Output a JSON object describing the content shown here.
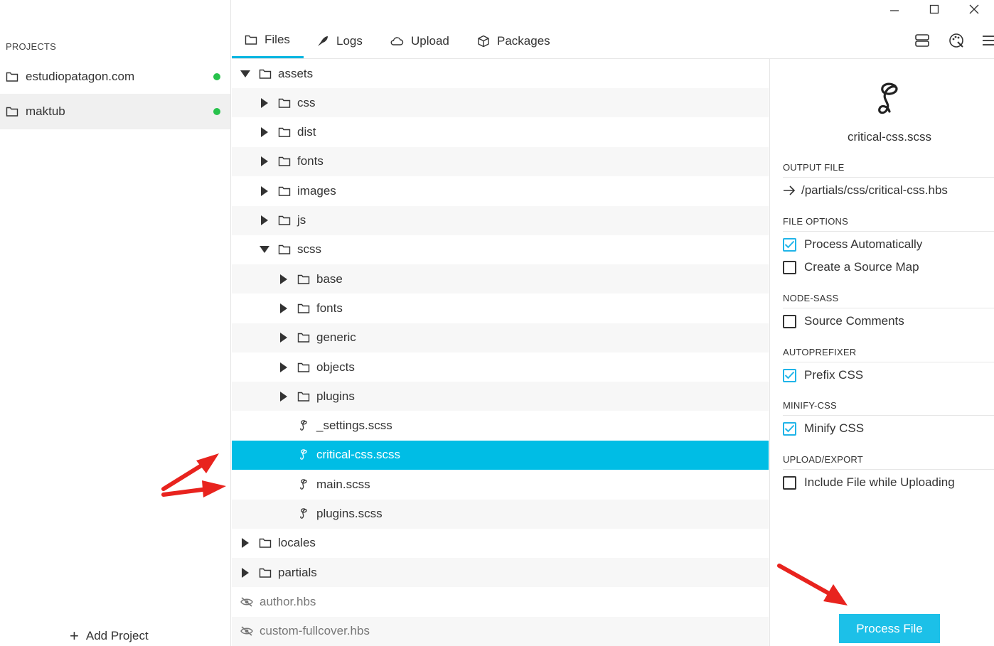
{
  "sidebar": {
    "title": "PROJECTS",
    "projects": [
      {
        "name": "estudiopatagon.com",
        "status_color": "#27c24c"
      },
      {
        "name": "maktub",
        "status_color": "#27c24c"
      }
    ],
    "add_label": "Add Project"
  },
  "tabs": [
    {
      "label": "Files",
      "icon": "folder-icon"
    },
    {
      "label": "Logs",
      "icon": "feather-icon"
    },
    {
      "label": "Upload",
      "icon": "cloud-icon"
    },
    {
      "label": "Packages",
      "icon": "box-icon"
    }
  ],
  "toolbar_icons": [
    "server-icon",
    "palette-icon",
    "menu-icon"
  ],
  "tree": [
    {
      "label": "assets",
      "type": "folder",
      "expanded": true
    },
    {
      "label": "css",
      "type": "folder"
    },
    {
      "label": "dist",
      "type": "folder"
    },
    {
      "label": "fonts",
      "type": "folder"
    },
    {
      "label": "images",
      "type": "folder"
    },
    {
      "label": "js",
      "type": "folder"
    },
    {
      "label": "scss",
      "type": "folder",
      "expanded": true
    },
    {
      "label": "base",
      "type": "folder"
    },
    {
      "label": "fonts",
      "type": "folder"
    },
    {
      "label": "generic",
      "type": "folder"
    },
    {
      "label": "objects",
      "type": "folder"
    },
    {
      "label": "plugins",
      "type": "folder"
    },
    {
      "label": "_settings.scss",
      "type": "sass"
    },
    {
      "label": "critical-css.scss",
      "type": "sass",
      "selected": true
    },
    {
      "label": "main.scss",
      "type": "sass"
    },
    {
      "label": "plugins.scss",
      "type": "sass"
    },
    {
      "label": "locales",
      "type": "folder"
    },
    {
      "label": "partials",
      "type": "folder"
    },
    {
      "label": "author.hbs",
      "type": "ignored"
    },
    {
      "label": "custom-fullcover.hbs",
      "type": "ignored"
    }
  ],
  "inspector": {
    "file_name": "critical-css.scss",
    "output_heading": "OUTPUT FILE",
    "output_path": "/partials/css/critical-css.hbs",
    "file_options_heading": "FILE OPTIONS",
    "process_auto": "Process Automatically",
    "source_map": "Create a Source Map",
    "node_sass_heading": "NODE-SASS",
    "source_comments": "Source Comments",
    "autoprefixer_heading": "AUTOPREFIXER",
    "prefix_css": "Prefix CSS",
    "minify_heading": "MINIFY-CSS",
    "minify_css": "Minify CSS",
    "upload_heading": "UPLOAD/EXPORT",
    "include_upload": "Include File while Uploading",
    "process_button": "Process File",
    "checked": {
      "process_auto": true,
      "source_map": false,
      "source_comments": false,
      "prefix_css": true,
      "minify_css": true,
      "include_upload": false
    }
  },
  "colors": {
    "accent": "#00bde5",
    "status": "#27c24c",
    "annotation": "#e8231e"
  }
}
